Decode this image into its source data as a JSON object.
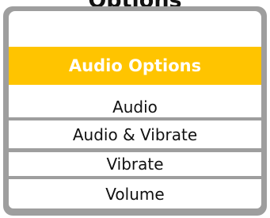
{
  "header_fragment": "Options",
  "menu": {
    "title": "Audio Options",
    "items": [
      {
        "label": "Audio"
      },
      {
        "label": "Audio & Vibrate"
      },
      {
        "label": "Vibrate"
      },
      {
        "label": "Volume"
      }
    ]
  },
  "colors": {
    "header_bg": "#ffc400",
    "header_text": "#ffffff",
    "frame": "#9e9e9e",
    "item_bg": "#ffffff",
    "item_text": "#111111"
  }
}
